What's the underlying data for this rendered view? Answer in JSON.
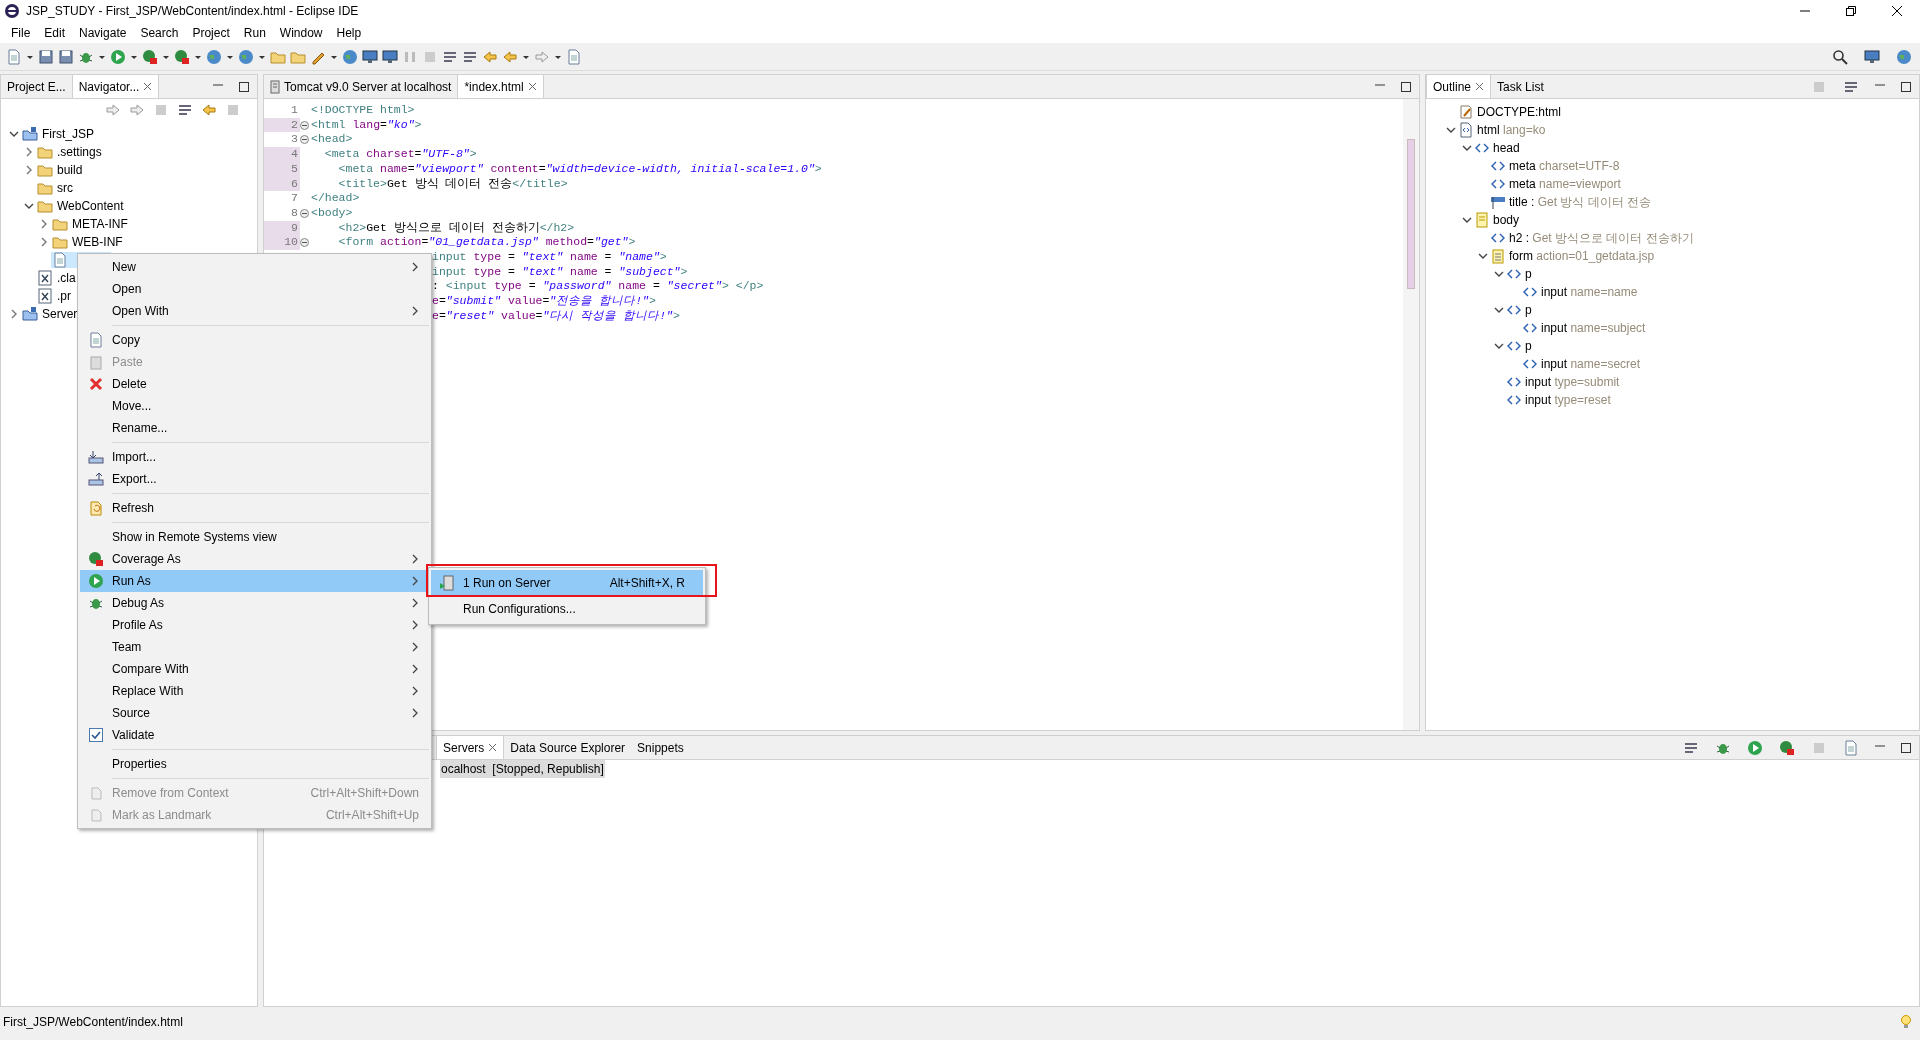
{
  "window": {
    "title": "JSP_STUDY - First_JSP/WebContent/index.html - Eclipse IDE"
  },
  "menu_bar": [
    "File",
    "Edit",
    "Navigate",
    "Search",
    "Project",
    "Run",
    "Window",
    "Help"
  ],
  "left_panel": {
    "tabs": [
      {
        "label": "Project E...",
        "selected": false,
        "closable": false
      },
      {
        "label": "Navigator...",
        "selected": true,
        "closable": true
      }
    ],
    "tree": [
      {
        "label": "First_JSP",
        "kind": "project",
        "expanded": true,
        "selected": false,
        "children": [
          {
            "label": ".settings",
            "kind": "folder",
            "expanded": false,
            "selected": false
          },
          {
            "label": "build",
            "kind": "folder",
            "expanded": false,
            "selected": false
          },
          {
            "label": "src",
            "kind": "folder",
            "selected": false
          },
          {
            "label": "WebContent",
            "kind": "folder",
            "expanded": true,
            "selected": false,
            "children": [
              {
                "label": "META-INF",
                "kind": "folder",
                "expanded": false,
                "selected": false
              },
              {
                "label": "WEB-INF",
                "kind": "folder",
                "expanded": false,
                "selected": false
              },
              {
                "kind": "file",
                "selected": true
              }
            ]
          },
          {
            "label": ".cla",
            "kind": "xml",
            "selected": false
          },
          {
            "label": ".pr",
            "kind": "xml",
            "selected": false
          }
        ]
      },
      {
        "label": "Server",
        "kind": "project",
        "expanded": false,
        "selected": false
      }
    ]
  },
  "editor": {
    "tabs": [
      {
        "label": "Tomcat v9.0 Server at localhost",
        "selected": false,
        "closable": false
      },
      {
        "label": "*index.html",
        "selected": true,
        "closable": true
      }
    ],
    "lines": [
      {
        "num": "1",
        "marked": false,
        "fold": false,
        "segments": [
          {
            "kind": "tag",
            "text": "<!DOCTYPE html>"
          }
        ]
      },
      {
        "num": "2",
        "marked": true,
        "fold": true,
        "segments": [
          {
            "kind": "tag",
            "text": "<html "
          },
          {
            "kind": "attr",
            "text": "lang"
          },
          {
            "kind": "plain",
            "text": "="
          },
          {
            "kind": "value",
            "text": "\"ko\""
          },
          {
            "kind": "tag",
            "text": ">"
          }
        ]
      },
      {
        "num": "3",
        "marked": false,
        "fold": true,
        "segments": [
          {
            "kind": "tag",
            "text": "<head>"
          }
        ]
      },
      {
        "num": "4",
        "marked": true,
        "fold": false,
        "segments": [
          {
            "kind": "tag",
            "text": "  <meta "
          },
          {
            "kind": "attr",
            "text": "charset"
          },
          {
            "kind": "plain",
            "text": "="
          },
          {
            "kind": "value",
            "text": "\"UTF-8\""
          },
          {
            "kind": "tag",
            "text": ">"
          }
        ]
      },
      {
        "num": "5",
        "marked": true,
        "fold": false,
        "segments": [
          {
            "kind": "tag",
            "text": "    <meta "
          },
          {
            "kind": "attr",
            "text": "name"
          },
          {
            "kind": "plain",
            "text": "="
          },
          {
            "kind": "value",
            "text": "\"viewport\""
          },
          {
            "kind": "attr",
            "text": " content"
          },
          {
            "kind": "plain",
            "text": "="
          },
          {
            "kind": "value",
            "text": "\"width=device-width, initial-scale=1.0\""
          },
          {
            "kind": "tag",
            "text": ">"
          }
        ]
      },
      {
        "num": "6",
        "marked": true,
        "fold": false,
        "segments": [
          {
            "kind": "tag",
            "text": "    <title>"
          },
          {
            "kind": "plain",
            "text": "Get 방식 데이터 전송"
          },
          {
            "kind": "tag",
            "text": "</title>"
          }
        ]
      },
      {
        "num": "7",
        "marked": false,
        "fold": false,
        "segments": [
          {
            "kind": "tag",
            "text": "</head>"
          }
        ]
      },
      {
        "num": "8",
        "marked": false,
        "fold": true,
        "segments": [
          {
            "kind": "tag",
            "text": "<body>"
          }
        ]
      },
      {
        "num": "9",
        "marked": true,
        "fold": false,
        "segments": [
          {
            "kind": "tag",
            "text": "    <h2>"
          },
          {
            "kind": "plain",
            "text": "Get 방식으로 데이터 전송하기"
          },
          {
            "kind": "tag",
            "text": "</h2>"
          }
        ]
      },
      {
        "num": "10",
        "marked": true,
        "fold": true,
        "segments": [
          {
            "kind": "tag",
            "text": "    <form "
          },
          {
            "kind": "attr",
            "text": "action"
          },
          {
            "kind": "plain",
            "text": "="
          },
          {
            "kind": "value",
            "text": "\"01_getdata.jsp\""
          },
          {
            "kind": "attr",
            "text": " method"
          },
          {
            "kind": "plain",
            "text": "="
          },
          {
            "kind": "value",
            "text": "\"get\""
          },
          {
            "kind": "tag",
            "text": ">"
          }
        ]
      },
      {
        "segments": [
          {
            "kind": "tag",
            "text": "input "
          },
          {
            "kind": "attr",
            "text": "type"
          },
          {
            "kind": "plain",
            "text": " = "
          },
          {
            "kind": "value",
            "text": "\"text\""
          },
          {
            "kind": "attr",
            "text": " name"
          },
          {
            "kind": "plain",
            "text": " = "
          },
          {
            "kind": "value",
            "text": "\"name\""
          },
          {
            "kind": "tag",
            "text": ">"
          }
        ]
      },
      {
        "segments": [
          {
            "kind": "tag",
            "text": "input "
          },
          {
            "kind": "attr",
            "text": "type"
          },
          {
            "kind": "plain",
            "text": " = "
          },
          {
            "kind": "value",
            "text": "\"text\""
          },
          {
            "kind": "attr",
            "text": " name"
          },
          {
            "kind": "plain",
            "text": " = "
          },
          {
            "kind": "value",
            "text": "\"subject\""
          },
          {
            "kind": "tag",
            "text": ">"
          }
        ]
      },
      {
        "segments": [
          {
            "kind": "plain",
            "text": ": "
          },
          {
            "kind": "tag",
            "text": "<input "
          },
          {
            "kind": "attr",
            "text": "type"
          },
          {
            "kind": "plain",
            "text": " = "
          },
          {
            "kind": "value",
            "text": "\"password\""
          },
          {
            "kind": "attr",
            "text": " name"
          },
          {
            "kind": "plain",
            "text": " = "
          },
          {
            "kind": "value",
            "text": "\"secret\""
          },
          {
            "kind": "tag",
            "text": "> </p>"
          }
        ]
      },
      {
        "segments": [
          {
            "kind": "attr",
            "text": "e"
          },
          {
            "kind": "plain",
            "text": "="
          },
          {
            "kind": "value",
            "text": "\"submit\""
          },
          {
            "kind": "attr",
            "text": " value"
          },
          {
            "kind": "plain",
            "text": "="
          },
          {
            "kind": "value",
            "text": "\"전송을 합니다!\""
          },
          {
            "kind": "tag",
            "text": ">"
          }
        ]
      },
      {
        "segments": [
          {
            "kind": "attr",
            "text": "e"
          },
          {
            "kind": "plain",
            "text": "="
          },
          {
            "kind": "value",
            "text": "\"reset\""
          },
          {
            "kind": "attr",
            "text": " value"
          },
          {
            "kind": "plain",
            "text": "="
          },
          {
            "kind": "value",
            "text": "\"다시 작성을 합니다!\""
          },
          {
            "kind": "tag",
            "text": ">"
          }
        ]
      }
    ]
  },
  "outline": {
    "tabs": [
      {
        "label": "Outline",
        "selected": true,
        "closable": true
      },
      {
        "label": "Task List",
        "selected": false,
        "closable": false
      }
    ],
    "tree": [
      {
        "name": "DOCTYPE:html",
        "kind": "doctype"
      },
      {
        "name": "html",
        "detail": "lang=ko",
        "kind": "html",
        "expanded": true,
        "children": [
          {
            "name": "head",
            "kind": "tag",
            "expanded": true,
            "children": [
              {
                "name": "meta",
                "detail": "charset=UTF-8",
                "kind": "tag"
              },
              {
                "name": "meta",
                "detail": "name=viewport",
                "kind": "tag"
              },
              {
                "name": "title :",
                "detail": "Get 방식 데이터 전송",
                "kind": "title"
              }
            ]
          },
          {
            "name": "body",
            "kind": "body",
            "expanded": true,
            "children": [
              {
                "name": "h2 :",
                "detail": "Get 방식으로 데이터 전송하기",
                "kind": "tag"
              },
              {
                "name": "form",
                "detail": "action=01_getdata.jsp",
                "kind": "form",
                "expanded": true,
                "children": [
                  {
                    "name": "p",
                    "kind": "tag",
                    "expanded": true,
                    "children": [
                      {
                        "name": "input",
                        "detail": "name=name",
                        "kind": "tag"
                      }
                    ]
                  },
                  {
                    "name": "p",
                    "kind": "tag",
                    "expanded": true,
                    "children": [
                      {
                        "name": "input",
                        "detail": "name=subject",
                        "kind": "tag"
                      }
                    ]
                  },
                  {
                    "name": "p",
                    "kind": "tag",
                    "expanded": true,
                    "children": [
                      {
                        "name": "input",
                        "detail": "name=secret",
                        "kind": "tag"
                      }
                    ]
                  },
                  {
                    "name": "input",
                    "detail": "type=submit",
                    "kind": "tag"
                  },
                  {
                    "name": "input",
                    "detail": "type=reset",
                    "kind": "tag"
                  }
                ]
              }
            ]
          }
        ]
      }
    ]
  },
  "bottom_panel": {
    "tabs": [
      {
        "label": "Servers",
        "selected": true,
        "closable": true
      },
      {
        "label": "Data Source Explorer",
        "selected": false,
        "closable": false
      },
      {
        "label": "Snippets",
        "selected": false,
        "closable": false
      }
    ],
    "rows": [
      {
        "name": "ocalhost",
        "status": "[Stopped, Republish]",
        "selected": true
      }
    ]
  },
  "context_menu": [
    {
      "kind": "item",
      "label": "New",
      "submenu": true,
      "disabled": false,
      "selected": false
    },
    {
      "kind": "item",
      "label": "Open",
      "submenu": false,
      "disabled": false,
      "selected": false
    },
    {
      "kind": "item",
      "label": "Open With",
      "submenu": true,
      "disabled": false,
      "selected": false
    },
    {
      "kind": "separator"
    },
    {
      "kind": "item",
      "label": "Copy",
      "submenu": false,
      "disabled": false,
      "selected": false
    },
    {
      "kind": "item",
      "label": "Paste",
      "submenu": false,
      "disabled": true,
      "selected": false
    },
    {
      "kind": "item",
      "label": "Delete",
      "submenu": false,
      "disabled": false,
      "selected": false
    },
    {
      "kind": "item",
      "label": "Move...",
      "submenu": false,
      "disabled": false,
      "selected": false
    },
    {
      "kind": "item",
      "label": "Rename...",
      "submenu": false,
      "disabled": false,
      "selected": false
    },
    {
      "kind": "separator"
    },
    {
      "kind": "item",
      "label": "Import...",
      "submenu": false,
      "disabled": false,
      "selected": false
    },
    {
      "kind": "item",
      "label": "Export...",
      "submenu": false,
      "disabled": false,
      "selected": false
    },
    {
      "kind": "separator"
    },
    {
      "kind": "item",
      "label": "Refresh",
      "submenu": false,
      "disabled": false,
      "selected": false
    },
    {
      "kind": "separator"
    },
    {
      "kind": "item",
      "label": "Show in Remote Systems view",
      "submenu": false,
      "disabled": false,
      "selected": false
    },
    {
      "kind": "item",
      "label": "Coverage As",
      "submenu": true,
      "disabled": false,
      "selected": false
    },
    {
      "kind": "item",
      "label": "Run As",
      "submenu": true,
      "disabled": false,
      "selected": true
    },
    {
      "kind": "item",
      "label": "Debug As",
      "submenu": true,
      "disabled": false,
      "selected": false
    },
    {
      "kind": "item",
      "label": "Profile As",
      "submenu": true,
      "disabled": false,
      "selected": false
    },
    {
      "kind": "item",
      "label": "Team",
      "submenu": true,
      "disabled": false,
      "selected": false
    },
    {
      "kind": "item",
      "label": "Compare With",
      "submenu": true,
      "disabled": false,
      "selected": false
    },
    {
      "kind": "item",
      "label": "Replace With",
      "submenu": true,
      "disabled": false,
      "selected": false
    },
    {
      "kind": "item",
      "label": "Source",
      "submenu": true,
      "disabled": false,
      "selected": false
    },
    {
      "kind": "check",
      "label": "Validate",
      "checked": true,
      "disabled": false,
      "selected": false
    },
    {
      "kind": "separator"
    },
    {
      "kind": "item",
      "label": "Properties",
      "submenu": false,
      "disabled": false,
      "selected": false
    },
    {
      "kind": "separator"
    },
    {
      "kind": "item",
      "label": "Remove from Context",
      "shortcut": "Ctrl+Alt+Shift+Down",
      "submenu": false,
      "disabled": true,
      "selected": false
    },
    {
      "kind": "item",
      "label": "Mark as Landmark",
      "shortcut": "Ctrl+Alt+Shift+Up",
      "submenu": false,
      "disabled": true,
      "selected": false
    }
  ],
  "submenu": [
    {
      "label": "1 Run on Server",
      "shortcut": "Alt+Shift+X, R",
      "selected": true,
      "highlighted": true
    },
    {
      "label": "Run Configurations...",
      "selected": false,
      "highlighted": false
    }
  ],
  "status_bar": {
    "path": "First_JSP/WebContent/index.html"
  }
}
